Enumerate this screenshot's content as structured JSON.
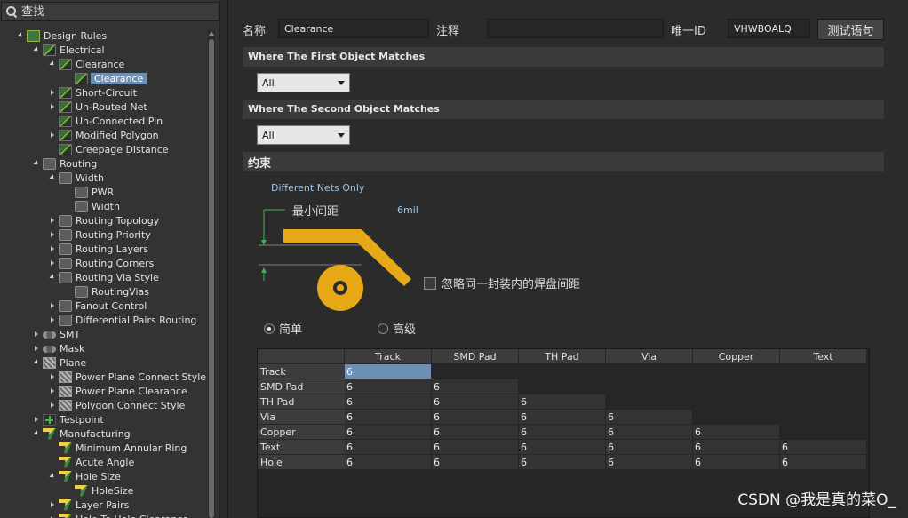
{
  "search": {
    "placeholder": "查找"
  },
  "tree": [
    {
      "label": "Design Rules",
      "level": 0,
      "arrow": "open",
      "icon": "root",
      "name": "tree-design-rules"
    },
    {
      "label": "Electrical",
      "level": 1,
      "arrow": "open",
      "icon": "rule-g",
      "name": "tree-electrical"
    },
    {
      "label": "Clearance",
      "level": 2,
      "arrow": "open",
      "icon": "rule-g",
      "name": "tree-clearance-group"
    },
    {
      "label": "Clearance",
      "level": 3,
      "arrow": "none",
      "icon": "rule-g",
      "name": "tree-clearance-rule",
      "selected": true
    },
    {
      "label": "Short-Circuit",
      "level": 2,
      "arrow": "closed",
      "icon": "rule-g",
      "name": "tree-short-circuit"
    },
    {
      "label": "Un-Routed Net",
      "level": 2,
      "arrow": "closed",
      "icon": "rule-g",
      "name": "tree-un-routed-net"
    },
    {
      "label": "Un-Connected Pin",
      "level": 2,
      "arrow": "none",
      "icon": "rule-g",
      "name": "tree-un-connected-pin"
    },
    {
      "label": "Modified Polygon",
      "level": 2,
      "arrow": "closed",
      "icon": "rule-g",
      "name": "tree-modified-polygon"
    },
    {
      "label": "Creepage Distance",
      "level": 2,
      "arrow": "none",
      "icon": "rule-g",
      "name": "tree-creepage-distance"
    },
    {
      "label": "Routing",
      "level": 1,
      "arrow": "open",
      "icon": "rule-b",
      "name": "tree-routing"
    },
    {
      "label": "Width",
      "level": 2,
      "arrow": "open",
      "icon": "rule-b",
      "name": "tree-width-group"
    },
    {
      "label": "PWR",
      "level": 3,
      "arrow": "none",
      "icon": "rule-b",
      "name": "tree-width-pwr"
    },
    {
      "label": "Width",
      "level": 3,
      "arrow": "none",
      "icon": "rule-b",
      "name": "tree-width-rule"
    },
    {
      "label": "Routing Topology",
      "level": 2,
      "arrow": "closed",
      "icon": "rule-b",
      "name": "tree-routing-topology"
    },
    {
      "label": "Routing Priority",
      "level": 2,
      "arrow": "closed",
      "icon": "rule-b",
      "name": "tree-routing-priority"
    },
    {
      "label": "Routing Layers",
      "level": 2,
      "arrow": "closed",
      "icon": "rule-b",
      "name": "tree-routing-layers"
    },
    {
      "label": "Routing Corners",
      "level": 2,
      "arrow": "closed",
      "icon": "rule-b",
      "name": "tree-routing-corners"
    },
    {
      "label": "Routing Via Style",
      "level": 2,
      "arrow": "open",
      "icon": "rule-b",
      "name": "tree-routing-via-style"
    },
    {
      "label": "RoutingVias",
      "level": 3,
      "arrow": "none",
      "icon": "rule-b",
      "name": "tree-routing-vias"
    },
    {
      "label": "Fanout Control",
      "level": 2,
      "arrow": "closed",
      "icon": "rule-b",
      "name": "tree-fanout-control"
    },
    {
      "label": "Differential Pairs Routing",
      "level": 2,
      "arrow": "closed",
      "icon": "rule-b",
      "name": "tree-diff-pairs-routing"
    },
    {
      "label": "SMT",
      "level": 1,
      "arrow": "closed",
      "icon": "rule-r",
      "name": "tree-smt"
    },
    {
      "label": "Mask",
      "level": 1,
      "arrow": "closed",
      "icon": "rule-r",
      "name": "tree-mask"
    },
    {
      "label": "Plane",
      "level": 1,
      "arrow": "open",
      "icon": "rule-p",
      "name": "tree-plane"
    },
    {
      "label": "Power Plane Connect Style",
      "level": 2,
      "arrow": "closed",
      "icon": "rule-p",
      "name": "tree-power-plane-connect-style"
    },
    {
      "label": "Power Plane Clearance",
      "level": 2,
      "arrow": "closed",
      "icon": "rule-p",
      "name": "tree-power-plane-clearance"
    },
    {
      "label": "Polygon Connect Style",
      "level": 2,
      "arrow": "closed",
      "icon": "rule-p",
      "name": "tree-polygon-connect-style"
    },
    {
      "label": "Testpoint",
      "level": 1,
      "arrow": "closed",
      "icon": "rule-t",
      "name": "tree-testpoint"
    },
    {
      "label": "Manufacturing",
      "level": 1,
      "arrow": "open",
      "icon": "rule-y",
      "name": "tree-manufacturing"
    },
    {
      "label": "Minimum Annular Ring",
      "level": 2,
      "arrow": "none",
      "icon": "rule-y",
      "name": "tree-min-annular-ring"
    },
    {
      "label": "Acute Angle",
      "level": 2,
      "arrow": "none",
      "icon": "rule-y",
      "name": "tree-acute-angle"
    },
    {
      "label": "Hole Size",
      "level": 2,
      "arrow": "open",
      "icon": "rule-y",
      "name": "tree-hole-size-group"
    },
    {
      "label": "HoleSize",
      "level": 3,
      "arrow": "none",
      "icon": "rule-y",
      "name": "tree-hole-size-rule"
    },
    {
      "label": "Layer Pairs",
      "level": 2,
      "arrow": "closed",
      "icon": "rule-y",
      "name": "tree-layer-pairs"
    },
    {
      "label": "Hole To Hole Clearance",
      "level": 2,
      "arrow": "closed",
      "icon": "rule-y",
      "name": "tree-hole-to-hole-clearance"
    }
  ],
  "form": {
    "name_label": "名称",
    "name_value": "Clearance",
    "comment_label": "注释",
    "comment_value": "",
    "uid_label": "唯一ID",
    "uid_value": "VHWBOALQ",
    "test_button": "测试语句"
  },
  "first_match": {
    "title": "Where The First Object Matches",
    "value": "All"
  },
  "second_match": {
    "title": "Where The Second Object Matches",
    "value": "All"
  },
  "constraints": {
    "title": "约束",
    "net_scope": "Different Nets Only",
    "min_clearance_label": "最小间距",
    "min_clearance_value": "6mil",
    "ignore_pad_label": "忽略同一封装内的焊盘间距",
    "mode_simple": "简单",
    "mode_advanced": "高级"
  },
  "matrix": {
    "columns": [
      "Track",
      "SMD Pad",
      "TH Pad",
      "Via",
      "Copper",
      "Text"
    ],
    "rows": [
      {
        "label": "Track",
        "values": [
          "6"
        ]
      },
      {
        "label": "SMD Pad",
        "values": [
          "6",
          "6"
        ]
      },
      {
        "label": "TH Pad",
        "values": [
          "6",
          "6",
          "6"
        ]
      },
      {
        "label": "Via",
        "values": [
          "6",
          "6",
          "6",
          "6"
        ]
      },
      {
        "label": "Copper",
        "values": [
          "6",
          "6",
          "6",
          "6",
          "6"
        ]
      },
      {
        "label": "Text",
        "values": [
          "6",
          "6",
          "6",
          "6",
          "6",
          "6"
        ]
      },
      {
        "label": "Hole",
        "values": [
          "6",
          "6",
          "6",
          "6",
          "6",
          "6"
        ]
      }
    ]
  },
  "watermark": "CSDN @我是真的菜O_",
  "colors": {
    "accent": "#6d8fb3",
    "trace": "#e6a817",
    "background": "#2b2b2b"
  }
}
